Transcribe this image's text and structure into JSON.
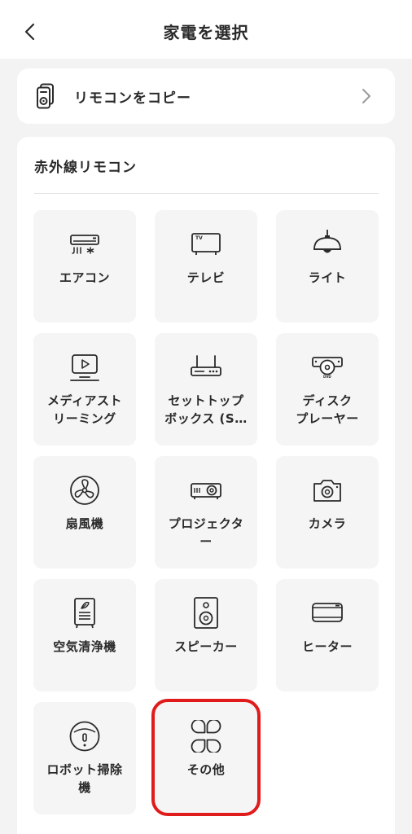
{
  "header": {
    "title": "家電を選択",
    "back_icon": "chevron-left-icon"
  },
  "copy_remote": {
    "label": "リモコンをコピー",
    "icon": "remote-copy-icon",
    "chevron_icon": "chevron-right-icon"
  },
  "ir_section": {
    "title": "赤外線リモコン",
    "tiles": [
      {
        "label": "エアコン",
        "icon": "air-conditioner-icon"
      },
      {
        "label": "テレビ",
        "icon": "tv-icon"
      },
      {
        "label": "ライト",
        "icon": "ceiling-light-icon"
      },
      {
        "label": "メディアスト\nリーミング",
        "icon": "media-streaming-icon"
      },
      {
        "label": "セットトップ\nボックス (S…",
        "icon": "set-top-box-icon"
      },
      {
        "label": "ディスク\nプレーヤー",
        "icon": "disc-player-icon"
      },
      {
        "label": "扇風機",
        "icon": "fan-icon"
      },
      {
        "label": "プロジェクタ\nー",
        "icon": "projector-icon"
      },
      {
        "label": "カメラ",
        "icon": "camera-icon"
      },
      {
        "label": "空気清浄機",
        "icon": "air-purifier-icon"
      },
      {
        "label": "スピーカー",
        "icon": "speaker-icon"
      },
      {
        "label": "ヒーター",
        "icon": "heater-icon"
      },
      {
        "label": "ロボット掃除\n機",
        "icon": "robot-vacuum-icon"
      },
      {
        "label": "その他",
        "icon": "other-icon"
      }
    ]
  },
  "colors": {
    "background": "#f3f3f3",
    "card": "#ffffff",
    "tile": "#f5f5f5",
    "text": "#2a2a2a",
    "highlight": "#e01b1b"
  }
}
